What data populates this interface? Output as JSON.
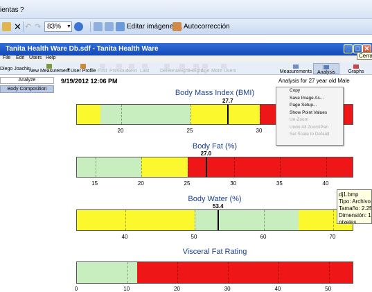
{
  "host": {
    "menu": [
      "ientas",
      "?"
    ],
    "zoom": "83%",
    "edit_images_label": "Editar imágenes...",
    "autocorrect_label": "Autocorrección",
    "close_tooltip": "Cerrar"
  },
  "window": {
    "title": "Tanita Health Ware Db.sdf - Tanita Health Ware",
    "menu": [
      "File",
      "Edit",
      "Users",
      "Help"
    ]
  },
  "toolbar": {
    "user_label": "Diego Joachin",
    "new_measurement": "New Measurement",
    "user_profile": "User Profile",
    "disabled": [
      "First",
      "Previous",
      "Next",
      "Last",
      "Delete",
      "Weight",
      "Height",
      "Age",
      "More Users"
    ],
    "measurements_label": "Measurements",
    "analysis_label": "Analysis",
    "graphs_label": "Graphs"
  },
  "left_panel": {
    "analyze_label": "Analyze",
    "body_composition_label": "Body Composition"
  },
  "report": {
    "date": "9/19/2012 12:06 PM",
    "analysis_for": "Analysis for 27 year old Male"
  },
  "colors": {
    "green": "#c8eec0",
    "yellow": "#fbf82d",
    "red": "#ee1616",
    "title_blue": "#1a3f8f"
  },
  "gauges": [
    {
      "title": "Body Mass Index (BMI)",
      "value": 27.7,
      "value_label": "27.7",
      "range": [
        16.8,
        36.8
      ],
      "segments": [
        {
          "from": 16.8,
          "to": 18.5,
          "color": "yellow"
        },
        {
          "from": 18.5,
          "to": 25,
          "color": "green"
        },
        {
          "from": 25,
          "to": 30,
          "color": "yellow"
        },
        {
          "from": 30,
          "to": 36.8,
          "color": "red"
        }
      ],
      "ticks": [
        20,
        25,
        30,
        35
      ]
    },
    {
      "title": "Body Fat (%)",
      "value": 27.0,
      "value_label": "27.0",
      "range": [
        13,
        43
      ],
      "segments": [
        {
          "from": 13,
          "to": 20,
          "color": "green"
        },
        {
          "from": 20,
          "to": 25,
          "color": "yellow"
        },
        {
          "from": 25,
          "to": 43,
          "color": "red"
        }
      ],
      "ticks": [
        15,
        20,
        25,
        30,
        35,
        40
      ]
    },
    {
      "title": "Body Water (%)",
      "value": 53.4,
      "value_label": "53.4",
      "range": [
        33,
        73
      ],
      "segments": [
        {
          "from": 33,
          "to": 50,
          "color": "yellow"
        },
        {
          "from": 50,
          "to": 65,
          "color": "green"
        },
        {
          "from": 65,
          "to": 73,
          "color": "yellow"
        }
      ],
      "ticks": [
        40,
        50,
        60,
        70
      ]
    },
    {
      "title": "Visceral Fat Rating",
      "value": 0,
      "value_label": "",
      "range": [
        0,
        55
      ],
      "segments": [
        {
          "from": 0,
          "to": 12,
          "color": "green"
        },
        {
          "from": 12,
          "to": 55,
          "color": "red"
        }
      ],
      "ticks": [
        0,
        10,
        20,
        30,
        40,
        50
      ]
    }
  ],
  "context_menu": {
    "items": [
      "Copy",
      "Save Image As...",
      "Page Setup...",
      "Show Point Values",
      "Un-Zoom",
      "Undo All Zoom/Pan",
      "Set Scale to Default"
    ],
    "disabled": [
      false,
      false,
      false,
      false,
      true,
      true,
      true
    ]
  },
  "file_tooltip": {
    "lines": [
      "dj1.bmp",
      "Tipo: Archivo B",
      "Tamaño: 2.25 M",
      "Dimensión: 102",
      "píxeles"
    ]
  }
}
